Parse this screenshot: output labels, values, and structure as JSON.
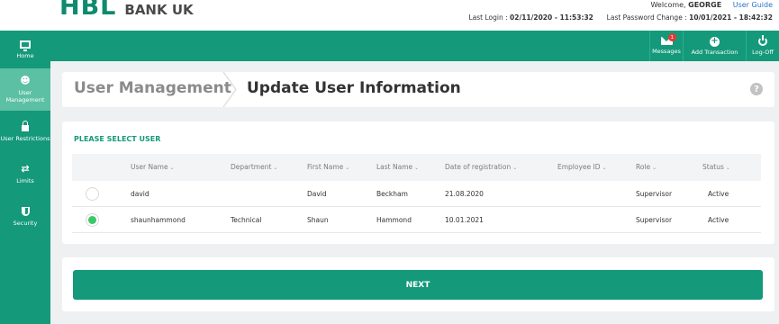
{
  "brand": {
    "mark": "HBL",
    "name": "BANK UK",
    "color": "#14997a"
  },
  "header": {
    "welcome_prefix": "Welcome,",
    "user": "GEORGE",
    "user_guide": "User Guide",
    "last_login_label": "Last Login :",
    "last_login_value": "02/11/2020 - 11:53:32",
    "last_pw_label": "Last Password Change :",
    "last_pw_value": "10/01/2021 - 18:42:32"
  },
  "nav": {
    "messages": {
      "label": "Messages",
      "badge": "1",
      "icon": "envelope-icon"
    },
    "add_transaction": {
      "label": "Add Transaction",
      "icon": "plus-circle-icon"
    },
    "logoff": {
      "label": "Log-Off",
      "icon": "power-icon"
    }
  },
  "sidebar": {
    "items": [
      {
        "label": "Home",
        "icon": "monitor-icon",
        "active": false
      },
      {
        "label": "User Management",
        "icon": "users-icon",
        "active": true
      },
      {
        "label": "User Restrictions",
        "icon": "lock-icon",
        "active": false
      },
      {
        "label": "Limits",
        "icon": "transfer-arrows-icon",
        "active": false
      },
      {
        "label": "Security",
        "icon": "shield-icon",
        "active": false
      }
    ]
  },
  "title": {
    "crumb_parent": "User Management",
    "crumb_current": "Update User Information",
    "help": "?"
  },
  "table": {
    "section_title": "PLEASE SELECT USER",
    "columns": [
      "User Name",
      "Department",
      "First Name",
      "Last Name",
      "Date of registration",
      "Employee ID",
      "Role",
      "Status"
    ],
    "rows": [
      {
        "selected": false,
        "username": "david",
        "department": "",
        "first_name": "David",
        "last_name": "Beckham",
        "date": "21.08.2020",
        "employee_id": "",
        "role": "Supervisor",
        "status": "Active"
      },
      {
        "selected": true,
        "username": "shaunhammond",
        "department": "Technical",
        "first_name": "Shaun",
        "last_name": "Hammond",
        "date": "10.01.2021",
        "employee_id": "",
        "role": "Supervisor",
        "status": "Active"
      }
    ]
  },
  "actions": {
    "next_label": "NEXT"
  }
}
